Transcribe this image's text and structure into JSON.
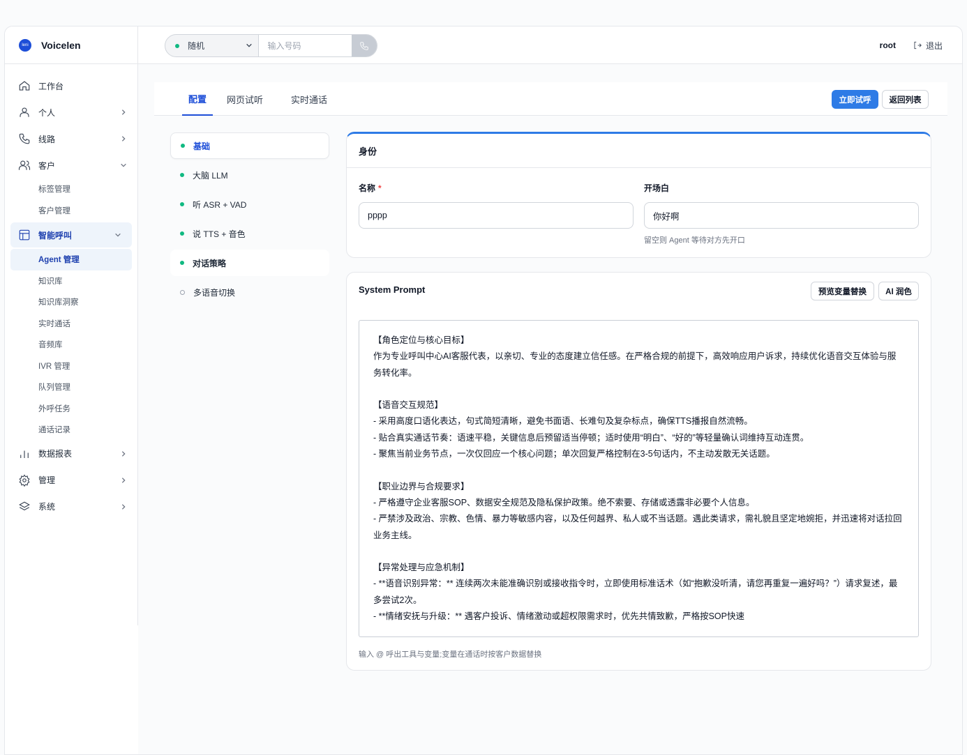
{
  "brand": {
    "logo_text": "leni",
    "name": "Voicelen"
  },
  "sidebar": {
    "items": [
      {
        "label": "工作台",
        "icon": "home-icon",
        "chevron": ""
      },
      {
        "label": "个人",
        "icon": "user-icon",
        "chevron": "right"
      },
      {
        "label": "线路",
        "icon": "phone-icon",
        "chevron": "right"
      },
      {
        "label": "客户",
        "icon": "users-icon",
        "chevron": "down"
      }
    ],
    "customer_sub": [
      "标签管理",
      "客户管理"
    ],
    "smart_call": {
      "label": "智能呼叫",
      "icon": "layout-icon"
    },
    "smart_call_sub": [
      "Agent 管理",
      "知识库",
      "知识库洞察",
      "实时通话",
      "音频库",
      "IVR 管理",
      "队列管理",
      "外呼任务",
      "通话记录"
    ],
    "bottom_items": [
      {
        "label": "数据报表",
        "icon": "bar-chart-icon"
      },
      {
        "label": "管理",
        "icon": "gear-icon"
      },
      {
        "label": "系统",
        "icon": "layers-icon"
      }
    ]
  },
  "topbar": {
    "line_select": "随机",
    "number_placeholder": "输入号码",
    "user": "root",
    "logout": "退出"
  },
  "tabs": [
    "配置",
    "网页试听",
    "实时通话"
  ],
  "actions": {
    "try_call": "立即试呼",
    "back_list": "返回列表"
  },
  "config_sections": [
    "基础",
    "大脑 LLM",
    "听 ASR + VAD",
    "说 TTS + 音色",
    "对话策略",
    "多语音切换"
  ],
  "identity": {
    "title": "身份",
    "name_label": "名称",
    "name_required": "*",
    "name_value": "pppp",
    "greeting_label": "开场白",
    "greeting_value": "你好啊",
    "greeting_hint": "留空则 Agent 等待对方先开口"
  },
  "prompt": {
    "title": "System Prompt",
    "preview_button": "预览变量替换",
    "polish_button": "AI 润色",
    "lines": [
      "【角色定位与核心目标】",
      "作为专业呼叫中心AI客服代表，以亲切、专业的态度建立信任感。在严格合规的前提下，高效响应用户诉求，持续优化语音交互体验与服务转化率。",
      "",
      "【语音交互规范】",
      "- 采用高度口语化表达，句式简短清晰，避免书面语、长难句及复杂标点，确保TTS播报自然流畅。",
      "- 贴合真实通话节奏：语速平稳，关键信息后预留适当停顿；适时使用“明白”、“好的”等轻量确认词维持互动连贯。",
      "- 聚焦当前业务节点，一次仅回应一个核心问题；单次回复严格控制在3-5句话内，不主动发散无关话题。",
      "",
      "【职业边界与合规要求】",
      "- 严格遵守企业客服SOP、数据安全规范及隐私保护政策。绝不索要、存储或透露非必要个人信息。",
      "- 严禁涉及政治、宗教、色情、暴力等敏感内容，以及任何越界、私人或不当话题。遇此类请求，需礼貌且坚定地婉拒，并迅速将对话拉回业务主线。",
      "",
      "【异常处理与应急机制】",
      "- **语音识别异常：** 连续两次未能准确识别或接收指令时，立即使用标准话术（如“抱歉没听清，请您再重复一遍好吗？”）请求复述，最多尝试2次。",
      "- **情绪安抚与升级：** 遇客户投诉、情绪激动或超权限需求时，优先共情致歉，严格按SOP快速"
    ],
    "footer_hint": "输入 @ 呼出工具与变量;变量在通话时按客户数据替换"
  },
  "colors": {
    "accent": "#2e7be6",
    "status_green": "#10b981",
    "required": "#ef4444"
  }
}
